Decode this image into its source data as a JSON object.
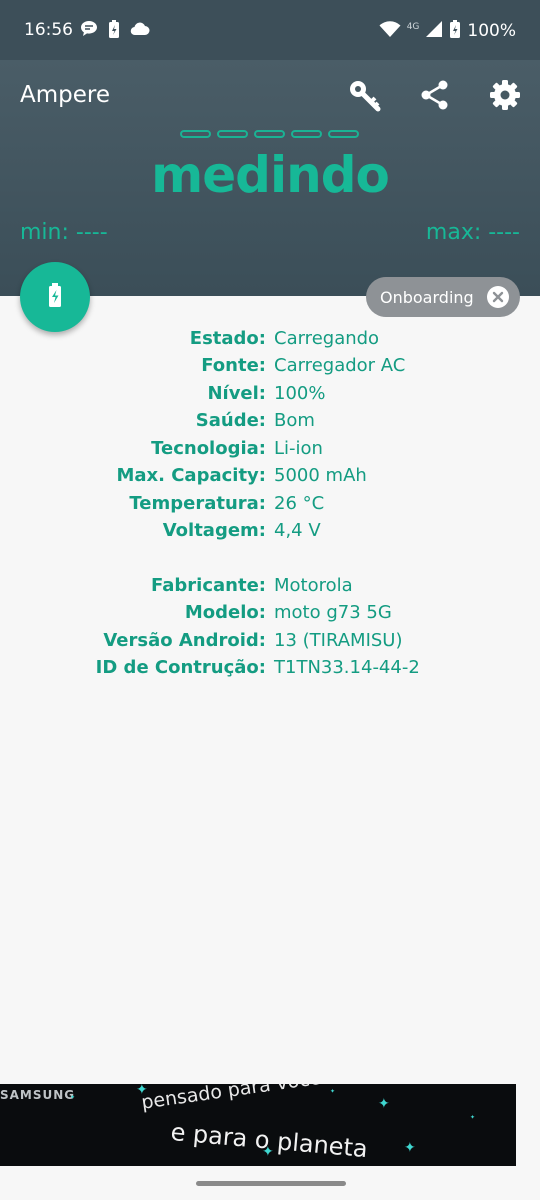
{
  "status_bar": {
    "time": "16:56",
    "network": "4G",
    "battery_pct": "100%",
    "left_icons": [
      "chat-bubble-icon",
      "battery-charging-icon",
      "cloud-icon"
    ],
    "right_icons": [
      "wifi-icon",
      "signal-icon",
      "battery-charging-icon"
    ]
  },
  "toolbar": {
    "title": "Ampere",
    "icons": [
      "key-icon",
      "share-icon",
      "gear-icon"
    ]
  },
  "measure": {
    "status": "medindo",
    "min_text": "min: ----",
    "max_text": "max: ----"
  },
  "fab": {
    "icon": "battery-charging-icon"
  },
  "chip": {
    "label": "Onboarding",
    "icon": "close-circle-icon"
  },
  "battery_info": [
    {
      "label": "Estado:",
      "value": "Carregando"
    },
    {
      "label": "Fonte:",
      "value": "Carregador AC"
    },
    {
      "label": "Nível:",
      "value": "100%"
    },
    {
      "label": "Saúde:",
      "value": "Bom"
    },
    {
      "label": "Tecnologia:",
      "value": "Li-ion"
    },
    {
      "label": "Max. Capacity:",
      "value": "5000 mAh"
    },
    {
      "label": "Temperatura:",
      "value": "26 °C"
    },
    {
      "label": "Voltagem:",
      "value": "4,4 V"
    }
  ],
  "device_info": [
    {
      "label": "Fabricante:",
      "value": "Motorola"
    },
    {
      "label": "Modelo:",
      "value": "moto g73 5G"
    },
    {
      "label": "Versão Android:",
      "value": "13 (TIRAMISU)"
    },
    {
      "label": "ID de Contrução:",
      "value": "T1TN33.14-44-2"
    }
  ],
  "ad": {
    "brand": "SAMSUNG",
    "line1": "pensado para você",
    "line2": "e para o planeta"
  },
  "colors": {
    "accent": "#17b897",
    "header_bg": "#435661",
    "label_color": "#149c82"
  }
}
